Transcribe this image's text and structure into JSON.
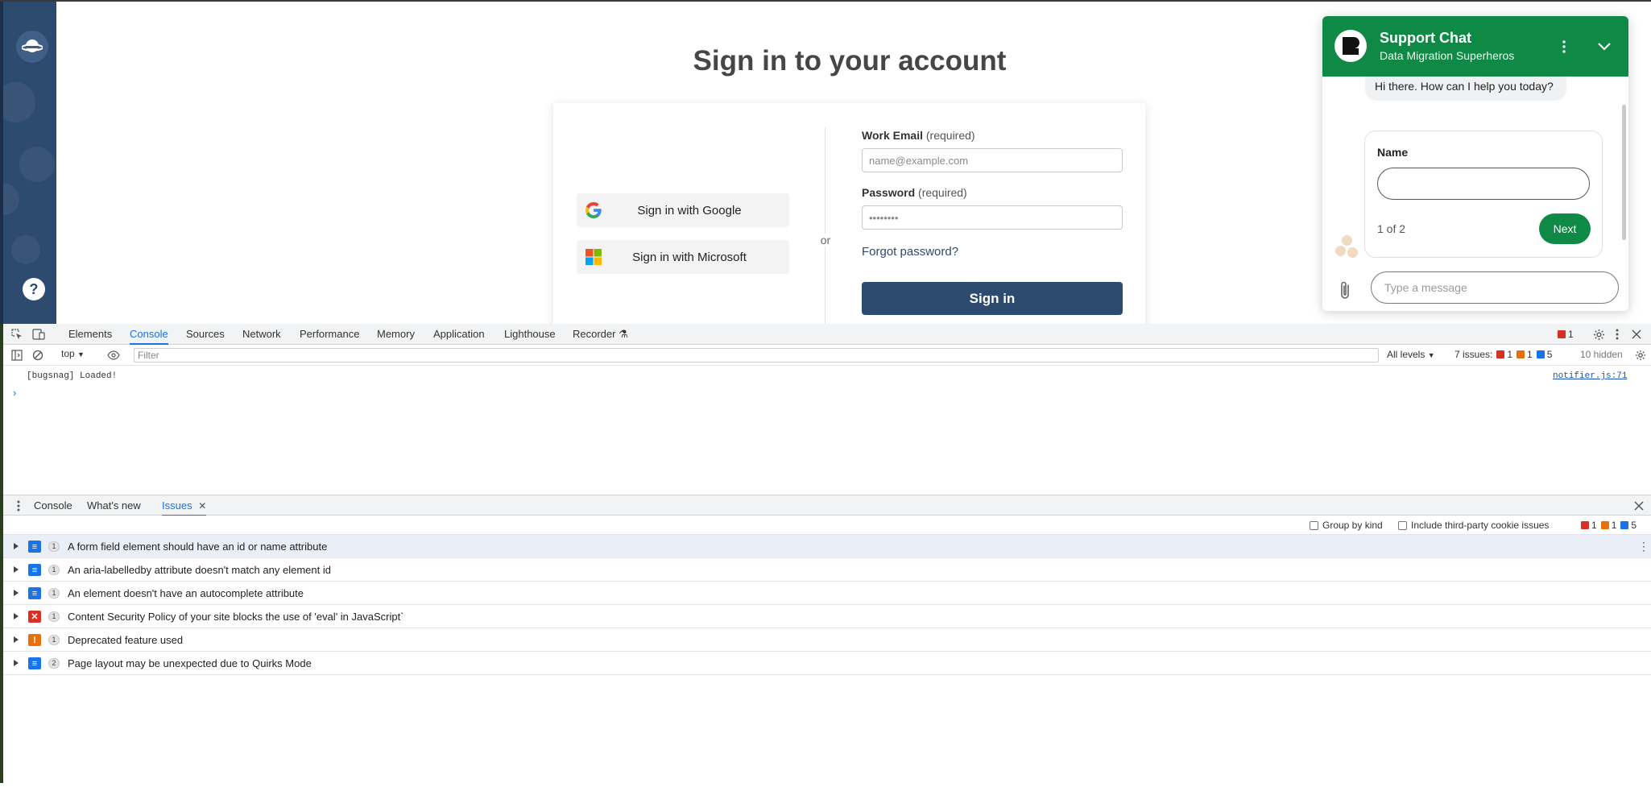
{
  "page": {
    "title": "Sign in to your account",
    "google_button": "Sign in with Google",
    "microsoft_button": "Sign in with Microsoft",
    "or": "or",
    "email_label": "Work Email",
    "email_required": "(required)",
    "email_placeholder": "name@example.com",
    "password_label": "Password",
    "password_required": "(required)",
    "password_placeholder": "••••••••",
    "forgot": "Forgot password?",
    "signin": "Sign in",
    "help": "?"
  },
  "chat": {
    "title": "Support Chat",
    "subtitle": "Data Migration Superheros",
    "message": "Hi there. How can I help you today?",
    "name_label": "Name",
    "step": "1 of 2",
    "next": "Next",
    "input_placeholder": "Type a message",
    "accent": "#0e8a46"
  },
  "devtools": {
    "tabs": [
      "Elements",
      "Console",
      "Sources",
      "Network",
      "Performance",
      "Memory",
      "Application",
      "Lighthouse",
      "Recorder"
    ],
    "active_tab": "Console",
    "error_count": "1",
    "context": "top",
    "filter_placeholder": "Filter",
    "levels": "All levels",
    "issues_label": "7 issues:",
    "issues_error": "1",
    "issues_warning": "1",
    "issues_info": "5",
    "hidden": "10 hidden",
    "log_message": "[bugsnag] Loaded!",
    "log_source": "notifier.js:71",
    "prompt": "›",
    "drawer_tabs": [
      "Console",
      "What's new",
      "Issues"
    ],
    "drawer_active": "Issues",
    "group_by_kind": "Group by kind",
    "third_party": "Include third-party cookie issues",
    "issues": [
      {
        "kind": "info",
        "count": "1",
        "title": "A form field element should have an id or name attribute"
      },
      {
        "kind": "info",
        "count": "1",
        "title": "An aria-labelledby attribute doesn't match any element id"
      },
      {
        "kind": "info",
        "count": "1",
        "title": "An element doesn't have an autocomplete attribute"
      },
      {
        "kind": "error",
        "count": "1",
        "title": "Content Security Policy of your site blocks the use of 'eval' in JavaScript`"
      },
      {
        "kind": "warning",
        "count": "1",
        "title": "Deprecated feature used"
      },
      {
        "kind": "info",
        "count": "2",
        "title": "Page layout may be unexpected due to Quirks Mode"
      }
    ]
  }
}
